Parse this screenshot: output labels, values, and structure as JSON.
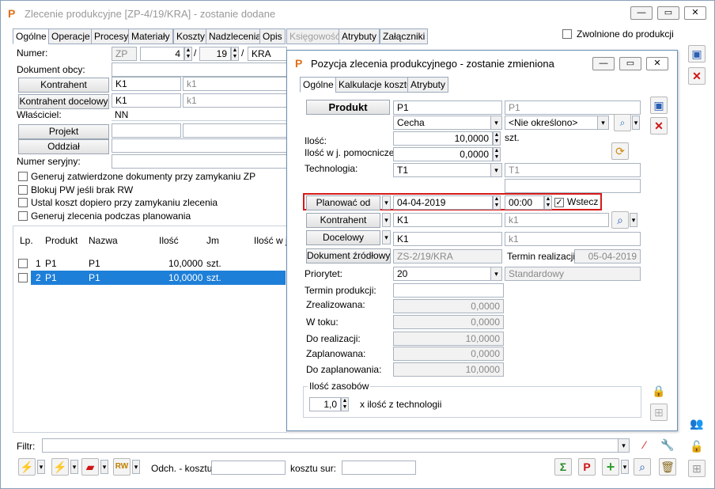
{
  "main": {
    "title": "Zlecenie produkcyjne  [ZP-4/19/KRA] - zostanie dodane",
    "tabs": [
      "Ogólne",
      "Operacje",
      "Procesy",
      "Materiały",
      "Koszty",
      "Nadzlecenia",
      "Opis",
      "Księgowość",
      "Atrybuty",
      "Załączniki"
    ],
    "zwolnione_label": "Zwolnione do produkcji",
    "numer_label": "Numer:",
    "numer_prefix": "ZP",
    "numer_number": "4",
    "numer_year": "19",
    "numer_series": "KRA",
    "dokument_obcy_label": "Dokument obcy:",
    "kontrahent_btn": "Kontrahent",
    "kontrahent_value": "K1",
    "kontrahent_name": "k1",
    "kontrahent_docelowy_btn": "Kontrahent docelowy",
    "kontrahent_docelowy_value": "K1",
    "kontrahent_docelowy_name": "k1",
    "wlasciciel_label": "Właściciel:",
    "wlasciciel_value": "NN",
    "projekt_btn": "Projekt",
    "oddzial_btn": "Oddział",
    "numer_seryjny_label": "Numer seryjny:",
    "checkboxes": [
      "Generuj zatwierdzone dokumenty przy zamykaniu ZP",
      "Blokuj PW jeśli brak RW",
      "Ustal koszt dopiero przy zamykaniu zlecenia",
      "Generuj zlecenia podczas planowania"
    ],
    "table": {
      "headers": [
        "Lp.",
        "Produkt",
        "Nazwa",
        "Ilość",
        "Jm",
        "Ilość w j"
      ],
      "rows": [
        {
          "lp": "1",
          "produkt": "P1",
          "nazwa": "P1",
          "ilosc": "10,0000",
          "jm": "szt."
        },
        {
          "lp": "2",
          "produkt": "P1",
          "nazwa": "P1",
          "ilosc": "10,0000",
          "jm": "szt."
        }
      ]
    },
    "filtr_label": "Filtr:",
    "odch_label": "Odch. - kosztu:",
    "kosztu_sur_label": "kosztu sur:"
  },
  "dialog": {
    "title": "Pozycja zlecenia produkcyjnego - zostanie zmieniona",
    "tabs": [
      "Ogólne",
      "Kalkulacje kosztu",
      "Atrybuty"
    ],
    "produkt_btn": "Produkt",
    "produkt_value": "P1",
    "produkt_name": "P1",
    "cecha_value": "Cecha",
    "nieokreslono_value": "<Nie określono>",
    "ilosc_label": "Ilość:",
    "ilosc_value": "10,0000",
    "ilosc_unit": "szt.",
    "ilosc_pom_label": "Ilość w j. pomocniczej:",
    "ilosc_pom_value": "0,0000",
    "technologia_label": "Technologia:",
    "technologia_value": "T1",
    "technologia_name": "T1",
    "planowac_btn": "Planować od",
    "planowac_date": "04-04-2019",
    "planowac_time": "00:00",
    "wstecz_label": "Wstecz",
    "kontrahent_btn": "Kontrahent",
    "kontrahent_value": "K1",
    "kontrahent_name": "k1",
    "docelowy_btn": "Docelowy",
    "docelowy_value": "K1",
    "docelowy_name": "k1",
    "dokument_zrodlowy_btn": "Dokument źródłowy",
    "dokument_zrodlowy_value": "ZS-2/19/KRA",
    "termin_realizacji_label": "Termin realizacji:",
    "termin_realizacji_value": "05-04-2019",
    "priorytet_label": "Priorytet:",
    "priorytet_value": "20",
    "priorytet_name": "Standardowy",
    "termin_produkcji_label": "Termin produkcji:",
    "zrealizowana_label": "Zrealizowana:",
    "zrealizowana_value": "0,0000",
    "w_toku_label": "W toku:",
    "w_toku_value": "0,0000",
    "do_realizacji_label": "Do realizacji:",
    "do_realizacji_value": "10,0000",
    "zaplanowana_label": "Zaplanowana:",
    "zaplanowana_value": "0,0000",
    "do_zaplanowania_label": "Do zaplanowania:",
    "do_zaplanowania_value": "10,0000",
    "ilosc_zasobow_label": "Ilość zasobów",
    "ilosc_zasobow_value": "1,0",
    "x_ilosc_label": "x ilość z technologii"
  }
}
